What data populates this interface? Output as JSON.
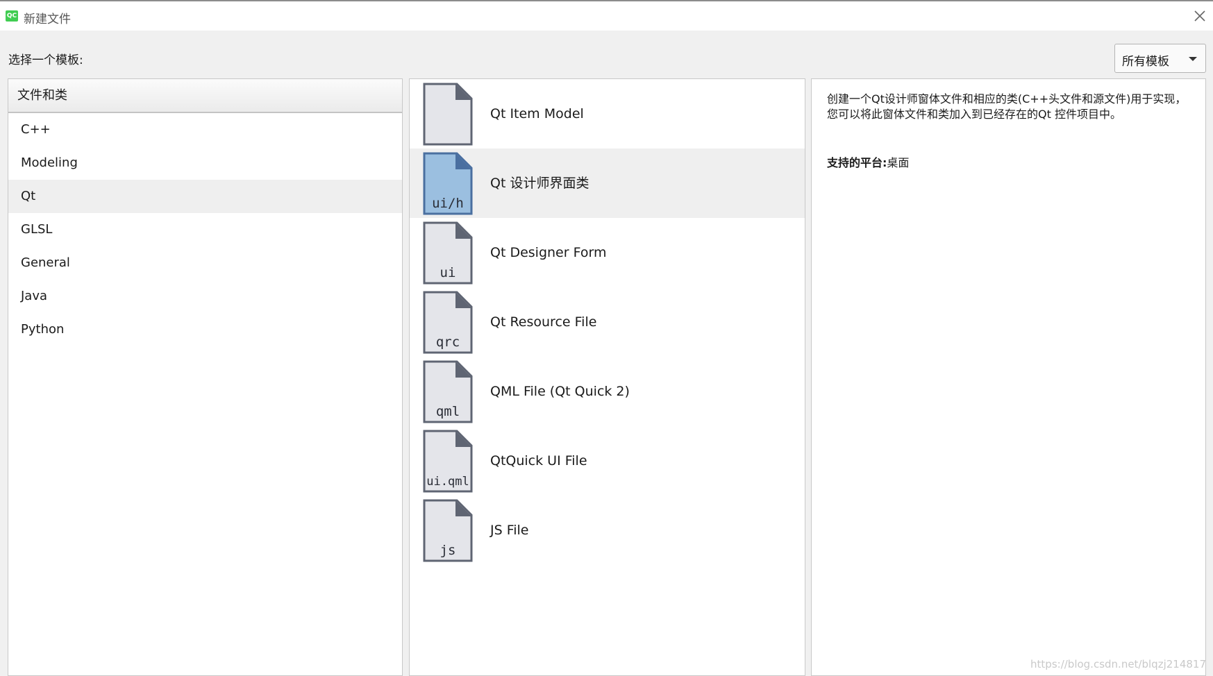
{
  "window": {
    "app_icon": "qt-logo-icon",
    "app_icon_text": "QC",
    "title": "新建文件",
    "close_icon": "close-icon"
  },
  "prompt": "选择一个模板:",
  "filter": {
    "selected": "所有模板",
    "icon": "chevron-down-icon"
  },
  "categories": {
    "header": "文件和类",
    "items": [
      {
        "label": "C++",
        "selected": false
      },
      {
        "label": "Modeling",
        "selected": false
      },
      {
        "label": "Qt",
        "selected": true
      },
      {
        "label": "GLSL",
        "selected": false
      },
      {
        "label": "General",
        "selected": false
      },
      {
        "label": "Java",
        "selected": false
      },
      {
        "label": "Python",
        "selected": false
      }
    ]
  },
  "templates": [
    {
      "label": "Qt Item Model",
      "icon_text": "",
      "selected": false
    },
    {
      "label": "Qt 设计师界面类",
      "icon_text": "ui/h",
      "selected": true
    },
    {
      "label": "Qt Designer Form",
      "icon_text": "ui",
      "selected": false
    },
    {
      "label": "Qt Resource File",
      "icon_text": "qrc",
      "selected": false
    },
    {
      "label": "QML File (Qt Quick 2)",
      "icon_text": "qml",
      "selected": false
    },
    {
      "label": "QtQuick UI File",
      "icon_text": "ui.qml",
      "selected": false
    },
    {
      "label": "JS File",
      "icon_text": "js",
      "selected": false
    }
  ],
  "details": {
    "description": "创建一个Qt设计师窗体文件和相应的类(C++头文件和源文件)用于实现，您可以将此窗体文件和类加入到已经存在的Qt 控件项目中。",
    "platforms_label": "支持的平台:",
    "platforms_value": "桌面"
  },
  "watermark": "https://blog.csdn.net/blqzj214817",
  "colors": {
    "icon_fill": "#e4e5ea",
    "icon_stroke": "#5f6573",
    "icon_selected_fill": "#9bbfe0",
    "icon_selected_stroke": "#4a6fa0",
    "selection_bg": "#efefef"
  }
}
